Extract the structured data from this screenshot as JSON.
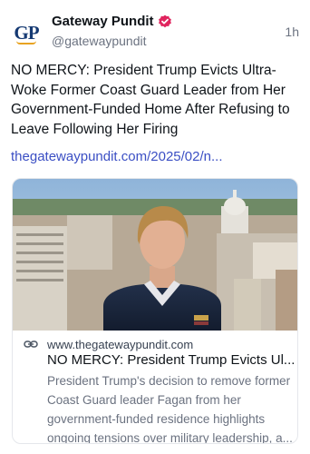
{
  "post": {
    "author_name": "Gateway Pundit",
    "author_handle": "@gatewaypundit",
    "avatar_text": "GP",
    "time": "1h",
    "text": "NO MERCY: President Trump Evicts Ultra-Woke Former Coast Guard Leader from Her Government-Funded Home After Refusing to Leave Following Her Firing",
    "link_text": "thegatewaypundit.com/2025/02/n..."
  },
  "link_card": {
    "domain": "www.thegatewaypundit.com",
    "title": "NO MERCY: President Trump Evicts Ul...",
    "description": "President Trump's decision to remove former Coast Guard leader Fagan from her government-funded residence highlights ongoing tensions over military leadership, a..."
  },
  "colors": {
    "link": "#3b4fc4",
    "verified_badge": "#e0245e",
    "muted_text": "#6b7280"
  },
  "icons": {
    "verified": "verified-badge-icon",
    "link": "link-icon"
  }
}
